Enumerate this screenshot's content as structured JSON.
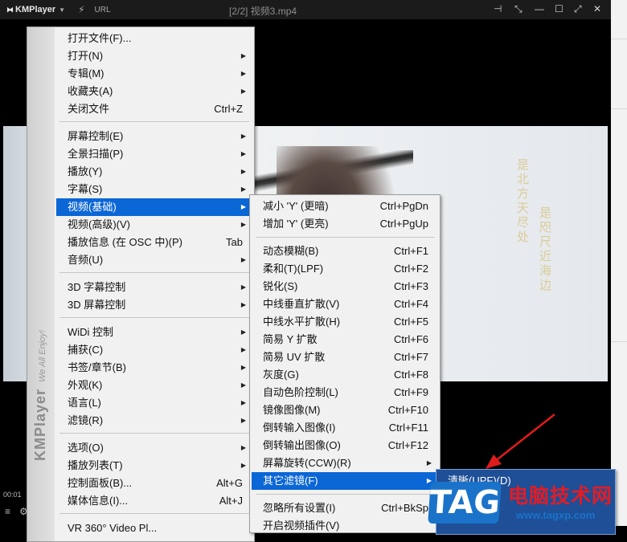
{
  "titlebar": {
    "app_name": "KMPlayer",
    "url_label": "URL",
    "file_title": "[2/2] 视频3.mp4"
  },
  "player": {
    "time": "00:01",
    "poem_left": "是北方天尽处",
    "poem_right": "是咫尺近海边"
  },
  "main_menu": {
    "side_brand": "KMPlayer",
    "side_tagline": "We All Enjoy!",
    "items": [
      {
        "label": "打开文件(F)...",
        "shortcut": ""
      },
      {
        "label": "打开(N)",
        "shortcut": ""
      },
      {
        "label": "专辑(M)",
        "shortcut": ""
      },
      {
        "label": "收藏夹(A)",
        "shortcut": ""
      },
      {
        "label": "关闭文件",
        "shortcut": "Ctrl+Z"
      },
      {
        "label": "屏幕控制(E)",
        "shortcut": ""
      },
      {
        "label": "全景扫描(P)",
        "shortcut": ""
      },
      {
        "label": "播放(Y)",
        "shortcut": ""
      },
      {
        "label": "字幕(S)",
        "shortcut": ""
      },
      {
        "label": "视频(基础)",
        "shortcut": ""
      },
      {
        "label": "视频(高级)(V)",
        "shortcut": ""
      },
      {
        "label": "播放信息 (在 OSC 中)(P)",
        "shortcut": "Tab"
      },
      {
        "label": "音频(U)",
        "shortcut": ""
      },
      {
        "label": "3D 字幕控制",
        "shortcut": ""
      },
      {
        "label": "3D 屏幕控制",
        "shortcut": ""
      },
      {
        "label": "WiDi 控制",
        "shortcut": ""
      },
      {
        "label": "捕获(C)",
        "shortcut": ""
      },
      {
        "label": "书签/章节(B)",
        "shortcut": ""
      },
      {
        "label": "外观(K)",
        "shortcut": ""
      },
      {
        "label": "语言(L)",
        "shortcut": ""
      },
      {
        "label": "滤镜(R)",
        "shortcut": ""
      },
      {
        "label": "选项(O)",
        "shortcut": ""
      },
      {
        "label": "播放列表(T)",
        "shortcut": ""
      },
      {
        "label": "控制面板(B)...",
        "shortcut": "Alt+G"
      },
      {
        "label": "媒体信息(I)...",
        "shortcut": "Alt+J"
      },
      {
        "label": "VR 360° Video Pl...",
        "shortcut": ""
      }
    ]
  },
  "video_menu": {
    "items": [
      {
        "label": "减小 'Y' (更暗)",
        "shortcut": "Ctrl+PgDn"
      },
      {
        "label": "增加 'Y' (更亮)",
        "shortcut": "Ctrl+PgUp"
      },
      {
        "label": "动态模糊(B)",
        "shortcut": "Ctrl+F1"
      },
      {
        "label": "柔和(T)(LPF)",
        "shortcut": "Ctrl+F2"
      },
      {
        "label": "锐化(S)",
        "shortcut": "Ctrl+F3"
      },
      {
        "label": "中线垂直扩散(V)",
        "shortcut": "Ctrl+F4"
      },
      {
        "label": "中线水平扩散(H)",
        "shortcut": "Ctrl+F5"
      },
      {
        "label": "简易 Y 扩散",
        "shortcut": "Ctrl+F6"
      },
      {
        "label": "简易 UV 扩散",
        "shortcut": "Ctrl+F7"
      },
      {
        "label": "灰度(G)",
        "shortcut": "Ctrl+F8"
      },
      {
        "label": "自动色阶控制(L)",
        "shortcut": "Ctrl+F9"
      },
      {
        "label": "镜像图像(M)",
        "shortcut": "Ctrl+F10"
      },
      {
        "label": "倒转输入图像(I)",
        "shortcut": "Ctrl+F11"
      },
      {
        "label": "倒转输出图像(O)",
        "shortcut": "Ctrl+F12"
      },
      {
        "label": "屏幕旋转(CCW)(R)",
        "shortcut": ""
      },
      {
        "label": "其它滤镜(F)",
        "shortcut": ""
      },
      {
        "label": "忽略所有设置(I)",
        "shortcut": "Ctrl+BkSp"
      },
      {
        "label": "开启视频插件(V)",
        "shortcut": ""
      }
    ]
  },
  "filter_menu": {
    "items": [
      {
        "label": "清晰(UPF)(D)"
      }
    ]
  },
  "watermark": {
    "tag": "TAG",
    "site_cn": "电脑技术网",
    "site_url": "www.tagxp.com"
  }
}
